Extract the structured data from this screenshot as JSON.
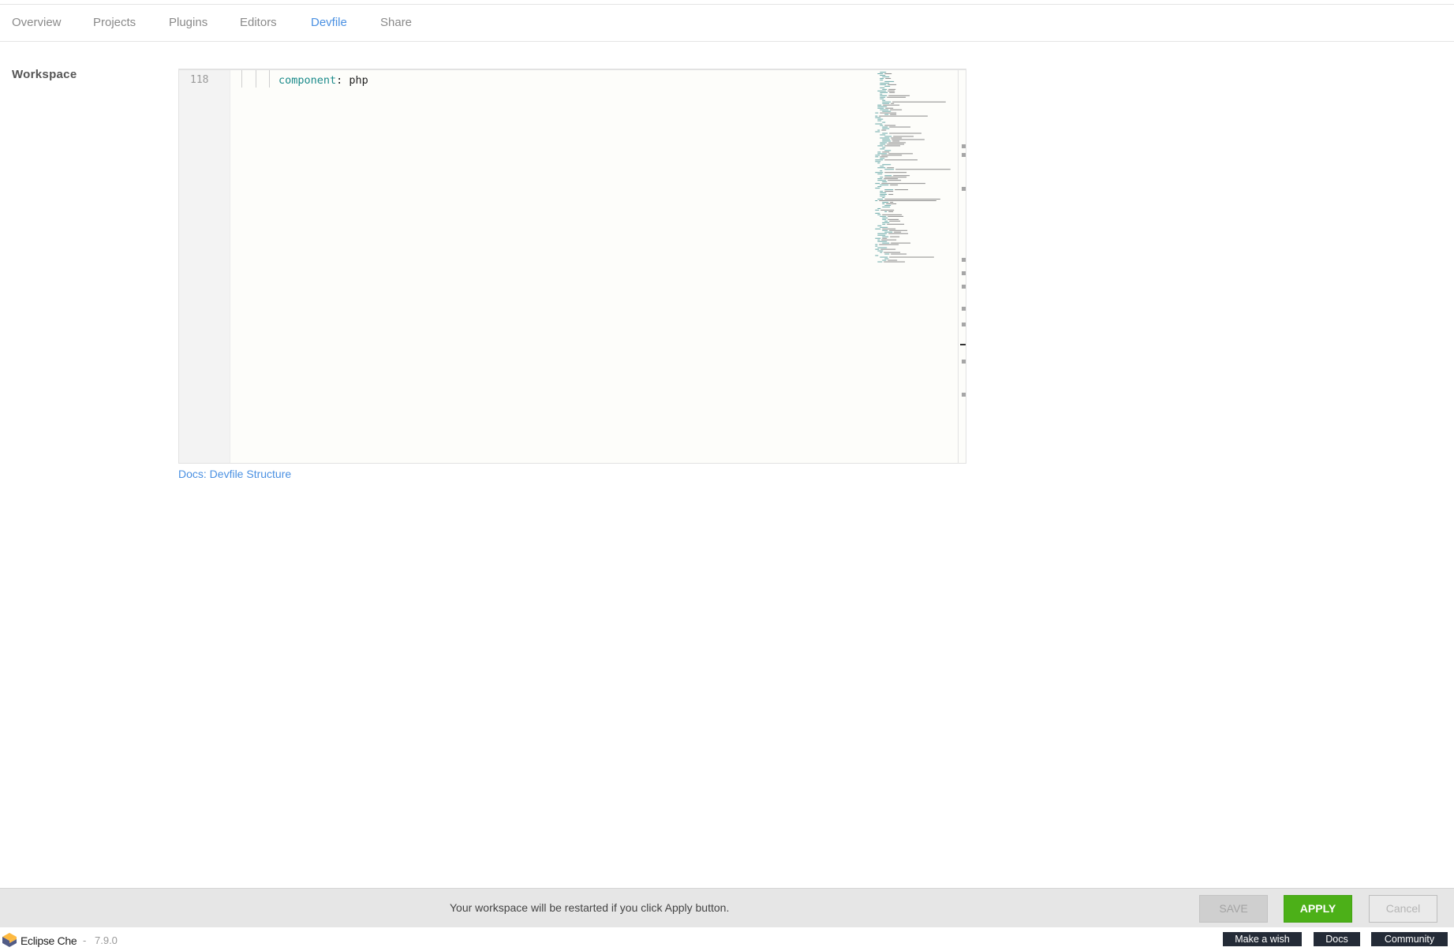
{
  "tabs": [
    {
      "label": "Overview"
    },
    {
      "label": "Projects"
    },
    {
      "label": "Plugins"
    },
    {
      "label": "Editors"
    },
    {
      "label": "Devfile",
      "active": true
    },
    {
      "label": "Share"
    }
  ],
  "section": {
    "label": "Workspace"
  },
  "editor": {
    "line_number": "118",
    "code_key": "component",
    "code_separator": ": ",
    "code_value": "php"
  },
  "docs_link": {
    "label": "Docs: Devfile Structure"
  },
  "footer": {
    "message": "Your workspace will be restarted if you click Apply button.",
    "save_label": "SAVE",
    "apply_label": "APPLY",
    "cancel_label": "Cancel"
  },
  "statusbar": {
    "brand": "Eclipse Che",
    "separator": "-",
    "version": "7.9.0",
    "make_wish_label": "Make a wish",
    "docs_label": "Docs",
    "community_label": "Community"
  },
  "colors": {
    "accent": "#4a90e2",
    "apply": "#4cb018",
    "statusbar_button": "#242b37",
    "logo_top": "#fdb940",
    "logo_side": "#525c86"
  }
}
